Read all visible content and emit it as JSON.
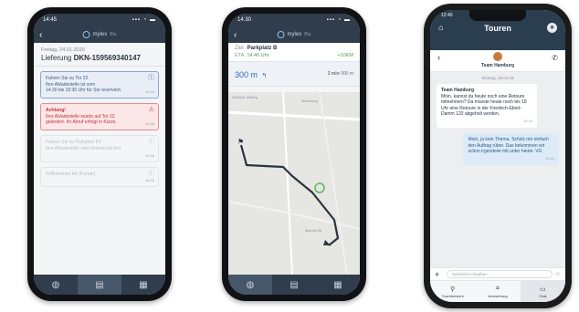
{
  "phone1": {
    "status_time": "14:45",
    "logo": "mylex",
    "logo_sub": "Blu",
    "date": "Freitag, 24.01.2020",
    "delivery_label": "Lieferung",
    "delivery_id": "DKN-159569340147",
    "cards": [
      {
        "type": "info",
        "lines": [
          "Fahren Sie zu Tor 22.",
          "Ihre Abladestelle ist vom",
          "14:30 bis 15:30 Uhr für Sie reserviert."
        ],
        "time": "14:43"
      },
      {
        "type": "warn",
        "title": "Achtung!",
        "lines": [
          "Ihre Abladestelle wurde auf Tor 22",
          "geändert. Ihr Abruf erfolgt in Kürze."
        ],
        "time": "14:38"
      },
      {
        "type": "muted",
        "lines": [
          "Fahren Sie zu Parkplatz P2",
          "Ihre Abladestelle wird demnächst frei."
        ],
        "time": "14:30"
      },
      {
        "type": "muted",
        "lines": [
          "Willkommen bei [Kunde]"
        ],
        "time": "14:02"
      }
    ],
    "tabs": [
      "globe-icon",
      "clipboard-icon",
      "document-icon"
    ]
  },
  "phone2": {
    "status_time": "14:30",
    "logo": "mylex",
    "logo_sub": "Blu",
    "target_label": "Ziel",
    "target": "Parkplatz B",
    "eta_label": "ETA",
    "eta": "14:46 Uhr",
    "eta_extra": "+10KM",
    "distance": "300 m",
    "remaining": "3 min",
    "remaining_extra": "900 m",
    "map_labels": [
      "Südlicher Wallring",
      "Ahrensburg",
      "Bahnhof Str."
    ],
    "tabs": [
      "globe-icon",
      "clipboard-icon",
      "document-icon"
    ]
  },
  "phone3": {
    "status_time": "12:40",
    "title": "Touren",
    "team_name": "Team Hamburg",
    "day_label": "Montag, 19.04.18",
    "messages": [
      {
        "dir": "in",
        "sender": "Team Hamburg",
        "text": "Moin, kannst du heute noch eine Retoure mitnehmen? Da müsste heute noch bis 18 Uhr eine Retoure in der Friedrich-Ebert-Damm 120 abgeholt werden.",
        "time": "10:24"
      },
      {
        "dir": "out",
        "text": "Moin, ja kein Thema. Schick mir einfach den Auftrag rüber. Das bekommen wir schon irgendwie mit unter heute. VG",
        "time": "10:44"
      }
    ],
    "input_placeholder": "Nachricht eingeben",
    "bottom_tabs": [
      "Tourübersicht",
      "Auswertung",
      "Chat"
    ]
  }
}
